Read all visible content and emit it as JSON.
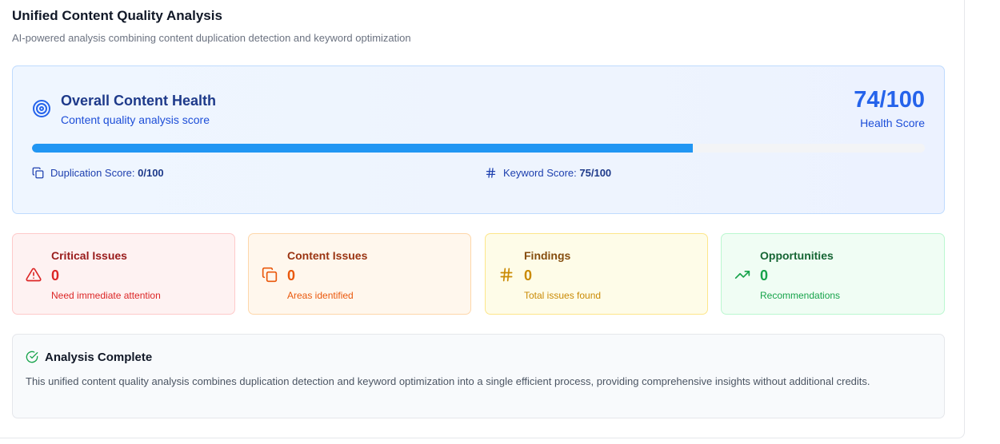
{
  "header": {
    "title": "Unified Content Quality Analysis",
    "subtitle": "AI-powered analysis combining content duplication detection and keyword optimization"
  },
  "health": {
    "icon": "target-icon",
    "title": "Overall Content Health",
    "subtitle": "Content quality analysis score",
    "score": "74/100",
    "score_label": "Health Score",
    "progress_fraction": 0.74,
    "duplication": {
      "icon": "copy-icon",
      "label": "Duplication Score:",
      "value": "0/100"
    },
    "keyword": {
      "icon": "hash-icon",
      "label": "Keyword Score:",
      "value": "75/100"
    }
  },
  "cards": {
    "critical": {
      "icon": "alert-triangle-icon",
      "title": "Critical Issues",
      "value": "0",
      "note": "Need immediate attention"
    },
    "content": {
      "icon": "copy-icon",
      "title": "Content Issues",
      "value": "0",
      "note": "Areas identified"
    },
    "findings": {
      "icon": "hash-icon",
      "title": "Findings",
      "value": "0",
      "note": "Total issues found"
    },
    "opportunities": {
      "icon": "trending-up-icon",
      "title": "Opportunities",
      "value": "0",
      "note": "Recommendations"
    }
  },
  "complete": {
    "icon": "check-circle-icon",
    "title": "Analysis Complete",
    "body": "This unified content quality analysis combines duplication detection and keyword optimization into a single efficient process, providing comprehensive insights without additional credits."
  },
  "colors": {
    "accent": "#2563eb",
    "progress": "#2196f3",
    "critical": "#dc2626",
    "content": "#ea580c",
    "findings": "#ca8a04",
    "opportunities": "#16a34a"
  }
}
